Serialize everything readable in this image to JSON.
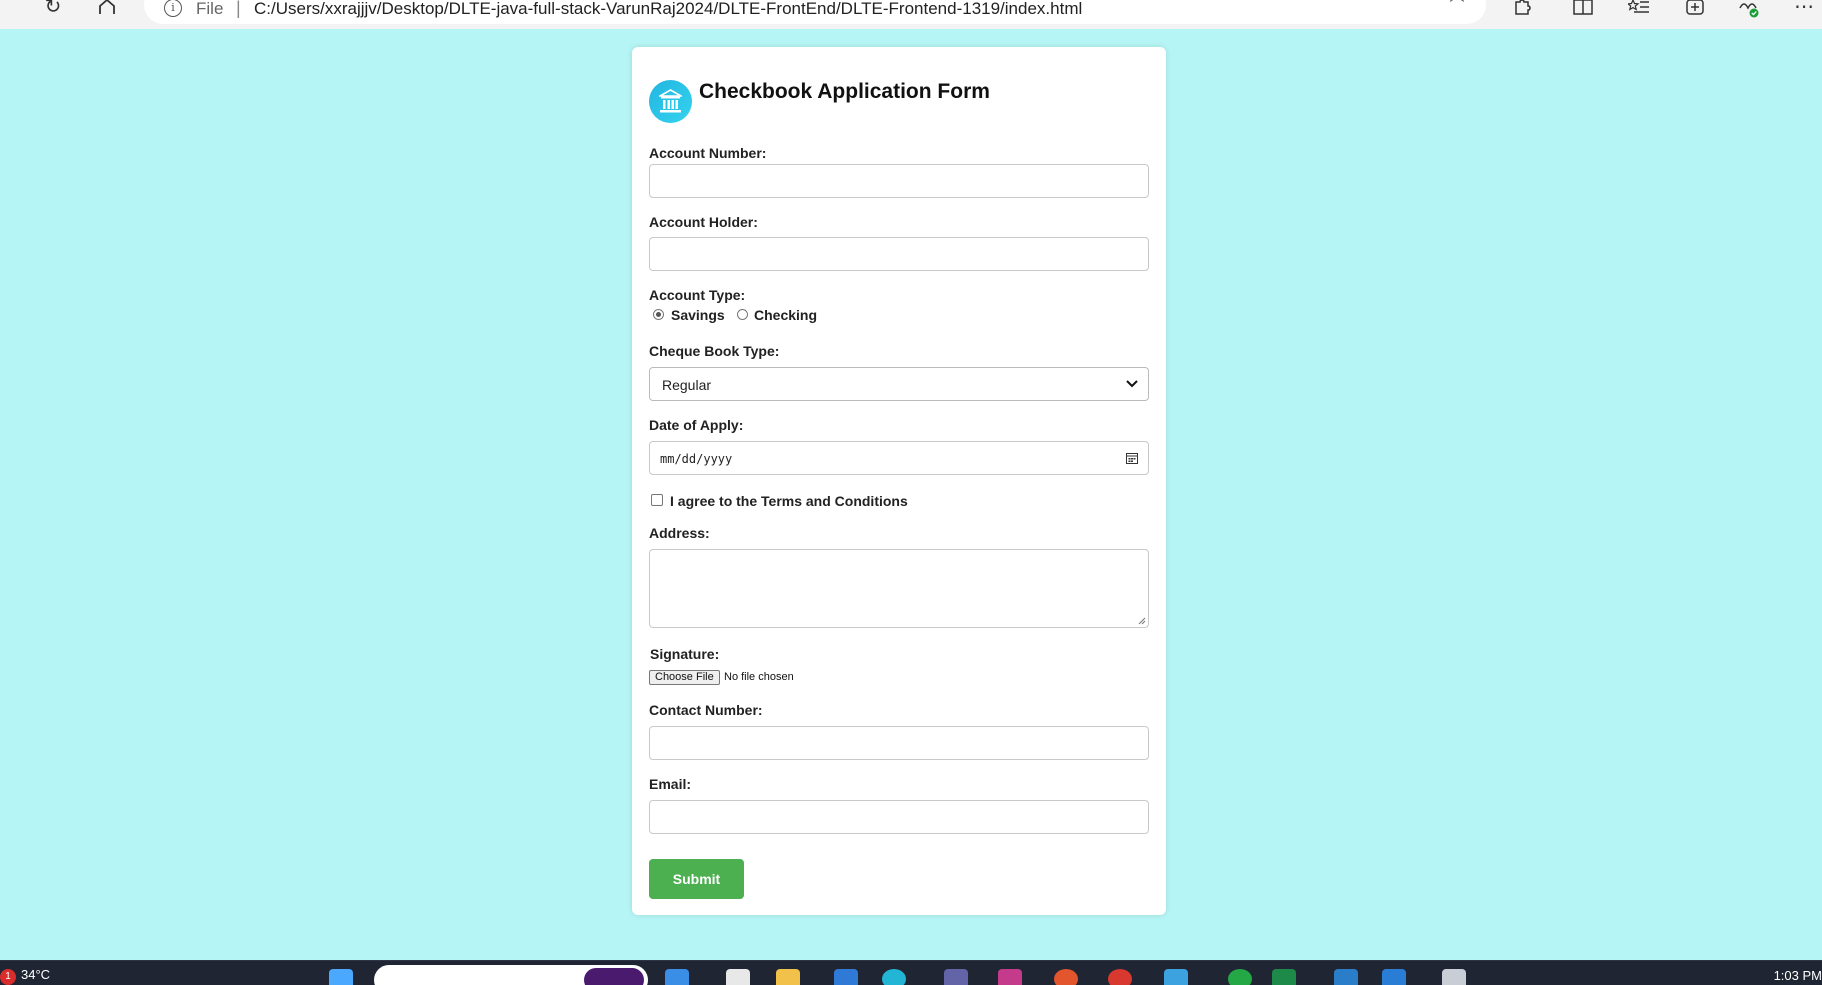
{
  "browser": {
    "address": {
      "scheme_label": "File",
      "separator": "|",
      "url": "C:/Users/xxrajjjv/Desktop/DLTE-java-full-stack-VarunRaj2024/DLTE-FrontEnd/DLTE-Frontend-1319/index.html",
      "info_icon": "i"
    },
    "icons": [
      "refresh-icon",
      "home-icon",
      "zoom-out-icon",
      "read-aloud-icon",
      "favorite-star-icon",
      "extensions-icon",
      "split-screen-icon",
      "favorites-icon",
      "collections-icon",
      "browser-essentials-icon",
      "more-icon"
    ]
  },
  "form": {
    "title": "Checkbook Application Form",
    "account_number": {
      "label": "Account Number:",
      "value": ""
    },
    "account_holder": {
      "label": "Account Holder:",
      "value": ""
    },
    "account_type": {
      "label": "Account Type:",
      "options": [
        "Savings",
        "Checking"
      ],
      "selected": "Savings"
    },
    "cheque_book_type": {
      "label": "Cheque Book Type:",
      "selected": "Regular"
    },
    "date_of_apply": {
      "label": "Date of Apply:",
      "placeholder": "mm/dd/yyyy"
    },
    "terms": {
      "label": "I agree to the Terms and Conditions",
      "checked": false
    },
    "address": {
      "label": "Address:",
      "value": ""
    },
    "signature": {
      "label": "Signature:",
      "button": "Choose File",
      "status": "No file chosen"
    },
    "contact_number": {
      "label": "Contact Number:",
      "value": ""
    },
    "email": {
      "label": "Email:",
      "value": ""
    },
    "submit_label": "Submit"
  },
  "colors": {
    "page_background": "#b6f5f5",
    "submit_button": "#4caf50",
    "logo_gradient": "#22b5e0"
  },
  "taskbar": {
    "weather": "34°C",
    "weather_badge": "1",
    "clock": "1:03 PM"
  }
}
